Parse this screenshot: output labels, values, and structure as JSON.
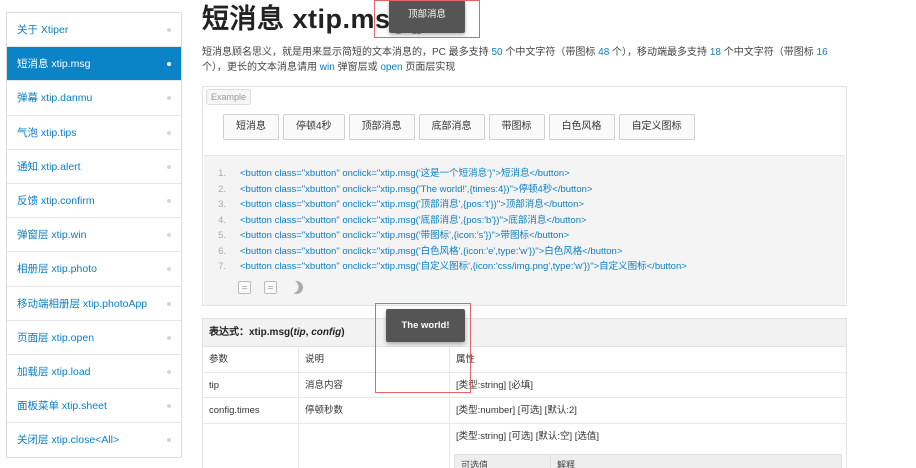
{
  "sidebar": {
    "items": [
      {
        "label": "关于 Xtiper",
        "active": false
      },
      {
        "label": "短消息 xtip.msg",
        "active": true
      },
      {
        "label": "弹幕 xtip.danmu",
        "active": false
      },
      {
        "label": "气泡 xtip.tips",
        "active": false
      },
      {
        "label": "通知 xtip.alert",
        "active": false
      },
      {
        "label": "反馈 xtip.confirm",
        "active": false
      },
      {
        "label": "弹窗层 xtip.win",
        "active": false
      },
      {
        "label": "相册层 xtip.photo",
        "active": false
      },
      {
        "label": "移动端相册层 xtip.photoApp",
        "active": false
      },
      {
        "label": "页面层 xtip.open",
        "active": false
      },
      {
        "label": "加载层 xtip.load",
        "active": false
      },
      {
        "label": "面板菜单 xtip.sheet",
        "active": false
      },
      {
        "label": "关闭层 xtip.close<All>",
        "active": false
      }
    ]
  },
  "main": {
    "title": "短消息 xtip.msg()",
    "desc": {
      "p1": "短消息顾名思义，就是用来显示简短的文本消息的，PC 最多支持 ",
      "n1": "50",
      "p2": " 个中文字符（带图标 ",
      "n2": "48",
      "p3": " 个），移动端最多支持 ",
      "n3": "18",
      "p4": " 个中文字符（带图标 ",
      "n4": "16",
      "p5": " 个），更长的文本消息请用 ",
      "link1": "win",
      "p6": " 弹窗层或 ",
      "link2": "open",
      "p7": " 页面层实现"
    },
    "example": {
      "label": "Example",
      "buttons": [
        "短消息",
        "停顿4秒",
        "顶部消息",
        "底部消息",
        "带图标",
        "白色风格",
        "自定义图标"
      ],
      "code": [
        {
          "n": "1.",
          "text": "<button class=\"xbutton\" onclick=\"xtip.msg('这是一个短消息')\">短消息</button>"
        },
        {
          "n": "2.",
          "text": "<button class=\"xbutton\" onclick=\"xtip.msg('The world!',{times:4})\">停顿4秒</button>"
        },
        {
          "n": "3.",
          "text": "<button class=\"xbutton\" onclick=\"xtip.msg('顶部消息',{pos:'t'})\">顶部消息</button>"
        },
        {
          "n": "4.",
          "text": "<button class=\"xbutton\" onclick=\"xtip.msg('底部消息',{pos:'b'})\">底部消息</button>"
        },
        {
          "n": "5.",
          "text": "<button class=\"xbutton\" onclick=\"xtip.msg('带图标',{icon:'s'})\">带图标</button>"
        },
        {
          "n": "6.",
          "text": "<button class=\"xbutton\" onclick=\"xtip.msg('白色风格',{icon:'e',type:'w'})\">白色风格</button>"
        },
        {
          "n": "7.",
          "text": "<button class=\"xbutton\" onclick=\"xtip.msg('自定义图标',{icon:'css/img.png',type:'w'})\">自定义图标</button>"
        }
      ],
      "tool_icons": [
        "copy-icon",
        "view-source-icon",
        "theme-moon-icon"
      ]
    },
    "table": {
      "expr_prefix": "表达式：xtip.msg(",
      "expr_arg1": "tip",
      "expr_sep": ", ",
      "expr_arg2": "config",
      "expr_suffix": ")",
      "headers": [
        "参数",
        "说明",
        "属性"
      ],
      "rows": [
        [
          "tip",
          "消息内容",
          "[类型:string] [必填]"
        ],
        [
          "config.times",
          "停顿秒数",
          "[类型:number] [可选] [默认:2]"
        ],
        [
          "",
          "",
          "[类型:string] [可选] [默认:空] [选值]"
        ]
      ],
      "sub_headers": [
        "可选值",
        "解释"
      ]
    }
  },
  "toasts": {
    "top": "顶部消息",
    "middle": "The world!"
  }
}
